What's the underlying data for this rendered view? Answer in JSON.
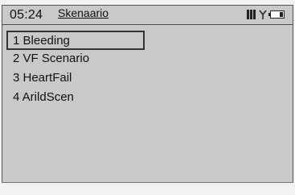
{
  "header": {
    "time": "05:24",
    "title": "Skenaario",
    "signal_icon": "signal-bars-icon",
    "antenna_icon": "antenna-icon",
    "battery_icon": "battery-icon"
  },
  "menu": {
    "items": [
      {
        "label": "1 Bleeding",
        "selected": true
      },
      {
        "label": "2  VF Scenario",
        "selected": false
      },
      {
        "label": "3  HeartFail",
        "selected": false
      },
      {
        "label": "4 ArildScen",
        "selected": false
      }
    ]
  }
}
